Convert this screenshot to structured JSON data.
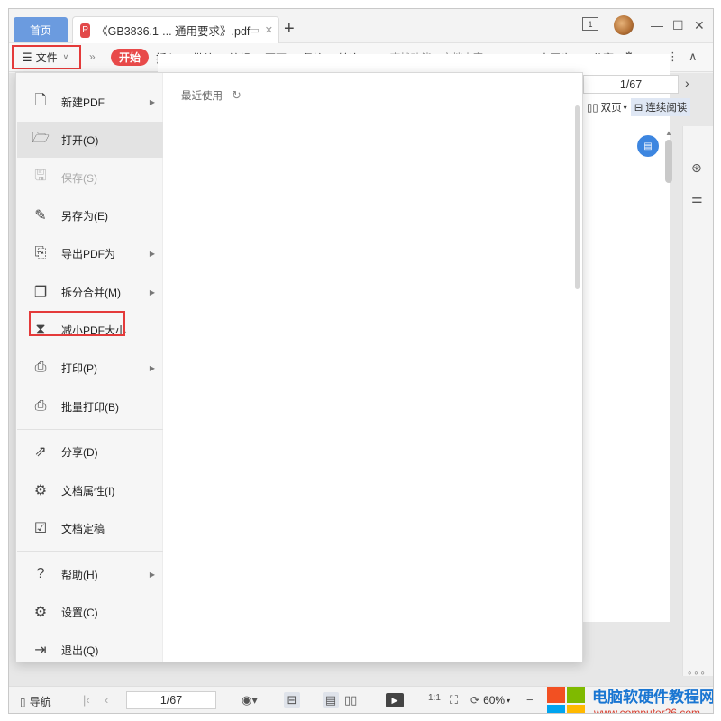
{
  "titlebar": {
    "home_tab": "首页",
    "doc_tab_badge": "P",
    "doc_tab_name": "《GB3836.1-... 通用要求》.pdf",
    "new_tab": "+",
    "pageview_icon": "1",
    "win_minimize": "—",
    "win_maximize": "☐",
    "win_close": "✕"
  },
  "ribbon": {
    "file_label": "文件",
    "more": "»",
    "tabs": [
      "开始",
      "插入",
      "批注",
      "编辑",
      "页面",
      "保护",
      "转换"
    ],
    "search_placeholder": "查找功能、文档内容",
    "sync_label": "未同步",
    "share_label": "分享"
  },
  "viewer": {
    "page_counter": "1/67",
    "dual_page": "双页",
    "continuous": "连续阅读"
  },
  "file_menu": {
    "items": [
      {
        "label": "新建PDF",
        "icon": "new-file-icon",
        "submenu": true
      },
      {
        "label": "打开(O)",
        "icon": "open-folder-icon",
        "submenu": false,
        "active": true
      },
      {
        "label": "保存(S)",
        "icon": "save-icon",
        "submenu": false,
        "disabled": true
      },
      {
        "label": "另存为(E)",
        "icon": "save-as-icon",
        "submenu": false
      },
      {
        "label": "导出PDF为",
        "icon": "export-pdf-icon",
        "submenu": true
      },
      {
        "label": "拆分合并(M)",
        "icon": "split-merge-icon",
        "submenu": true
      },
      {
        "label": "减小PDF大小",
        "icon": "compress-pdf-icon",
        "submenu": false
      },
      {
        "label": "打印(P)",
        "icon": "print-icon",
        "submenu": true
      },
      {
        "label": "批量打印(B)",
        "icon": "batch-print-icon",
        "submenu": false
      },
      {
        "label": "分享(D)",
        "icon": "share-icon",
        "submenu": false
      },
      {
        "label": "文档属性(I)",
        "icon": "doc-properties-icon",
        "submenu": false
      },
      {
        "label": "文档定稿",
        "icon": "finalize-icon",
        "submenu": false
      },
      {
        "label": "帮助(H)",
        "icon": "help-icon",
        "submenu": true
      },
      {
        "label": "设置(C)",
        "icon": "settings-icon",
        "submenu": false
      },
      {
        "label": "退出(Q)",
        "icon": "exit-icon",
        "submenu": false
      }
    ],
    "recent_label": "最近使用"
  },
  "statusbar": {
    "nav_label": "导航",
    "page_counter": "1/67",
    "zoom": "60%"
  },
  "watermark": {
    "title": "电脑软硬件教程网",
    "url": "www.computer26.com",
    "colors": [
      "#f25022",
      "#7fba00",
      "#00a4ef",
      "#ffb900"
    ]
  },
  "colors": {
    "accent_red": "#e84a4a",
    "home_tab_blue": "#6b9bdf",
    "highlight_red": "#e43a3a"
  }
}
